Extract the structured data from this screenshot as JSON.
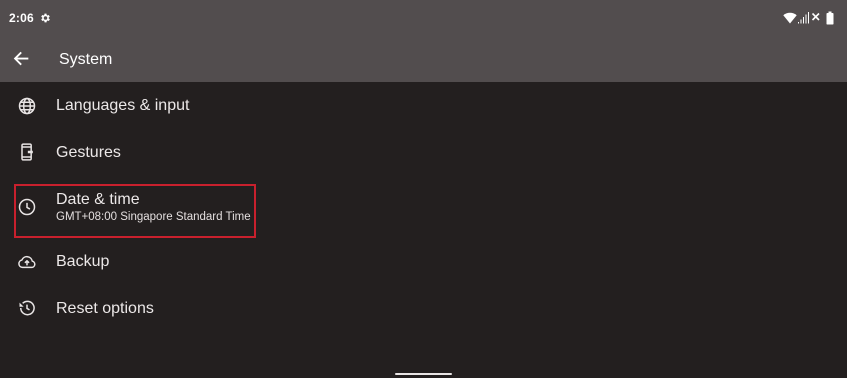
{
  "status_bar": {
    "time": "2:06",
    "icons": [
      "gear-icon",
      "wifi-icon",
      "signal-icon",
      "no-sim-icon",
      "battery-icon"
    ]
  },
  "app_bar": {
    "title": "System",
    "back_icon": "arrow-left-icon"
  },
  "items": [
    {
      "title": "Languages & input",
      "icon": "globe-icon"
    },
    {
      "title": "Gestures",
      "icon": "phone-gesture-icon"
    },
    {
      "title": "Date & time",
      "summary": "GMT+08:00 Singapore Standard Time",
      "icon": "clock-icon",
      "highlighted": true
    },
    {
      "title": "Backup",
      "icon": "cloud-upload-icon"
    },
    {
      "title": "Reset options",
      "icon": "history-icon"
    }
  ],
  "colors": {
    "bar_background": "#524d4e",
    "page_background": "#231f1f",
    "highlight_border": "#c8202d"
  }
}
